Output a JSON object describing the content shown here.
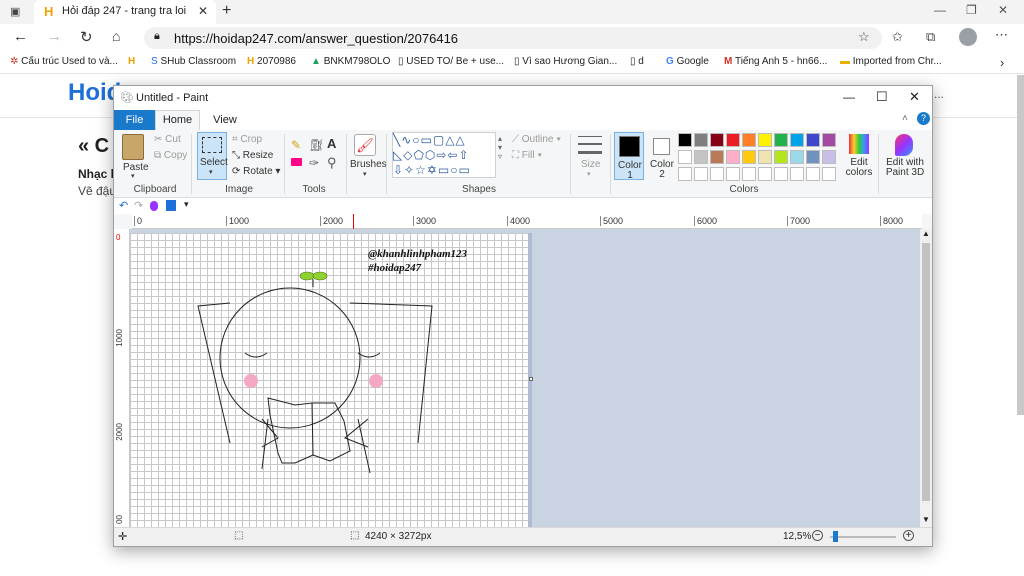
{
  "browser": {
    "tab_title": "Hỏi đáp 247 - trang tra loi",
    "url": "https://hoidap247.com/answer_question/2076416",
    "bookmarks": [
      {
        "label": "Cấu trúc Used to và..."
      },
      {
        "label": "SHub Classroom"
      },
      {
        "label": "2070986"
      },
      {
        "label": "BNKM798OLO"
      },
      {
        "label": "USED TO/ Be + use..."
      },
      {
        "label": "Vì sao Hương Gian..."
      },
      {
        "label": "d"
      },
      {
        "label": "Google"
      },
      {
        "label": "Tiếng Anh 5 - hn66..."
      },
      {
        "label": "Imported from Chr..."
      }
    ]
  },
  "site": {
    "logo": "Hoid",
    "heading": "« C",
    "line1": "Nhạc l",
    "line2": "Vẽ đậu",
    "more": "..."
  },
  "paint": {
    "window_title": "Untitled - Paint",
    "tabs": {
      "file": "File",
      "home": "Home",
      "view": "View"
    },
    "clipboard": {
      "group": "Clipboard",
      "paste": "Paste",
      "cut": "Cut",
      "copy": "Copy"
    },
    "image": {
      "group": "Image",
      "select": "Select",
      "crop": "Crop",
      "resize": "Resize",
      "rotate": "Rotate"
    },
    "tools": {
      "group": "Tools"
    },
    "brushes": {
      "label": "Brushes"
    },
    "shapes": {
      "group": "Shapes",
      "outline": "Outline",
      "fill": "Fill"
    },
    "size": {
      "label": "Size"
    },
    "colors": {
      "group": "Colors",
      "color1": "Color 1",
      "color2": "Color 2",
      "edit_colors": "Edit colors",
      "edit_paint3d": "Edit with Paint 3D",
      "palette_row1": [
        "#000000",
        "#7f7f7f",
        "#880015",
        "#ed1c24",
        "#ff7f27",
        "#fff200",
        "#22b14c",
        "#00a2e8",
        "#3f48cc",
        "#a349a4"
      ],
      "palette_row2": [
        "#ffffff",
        "#c3c3c3",
        "#b97a57",
        "#ffaec9",
        "#ffc90e",
        "#efe4b0",
        "#b5e61d",
        "#99d9ea",
        "#7092be",
        "#c8bfe7"
      ]
    },
    "ruler": {
      "h_ticks": [
        "0",
        "1000",
        "2000",
        "3000",
        "4000",
        "5000",
        "6000",
        "7000",
        "8000"
      ],
      "v_ticks": [
        "0",
        "1000",
        "2000",
        "00"
      ]
    },
    "drawing": {
      "text1": "@khanhlinhpham123",
      "text2": "#hoidap247"
    },
    "status": {
      "dimensions": "4240 × 3272px",
      "zoom": "12,5%"
    }
  }
}
